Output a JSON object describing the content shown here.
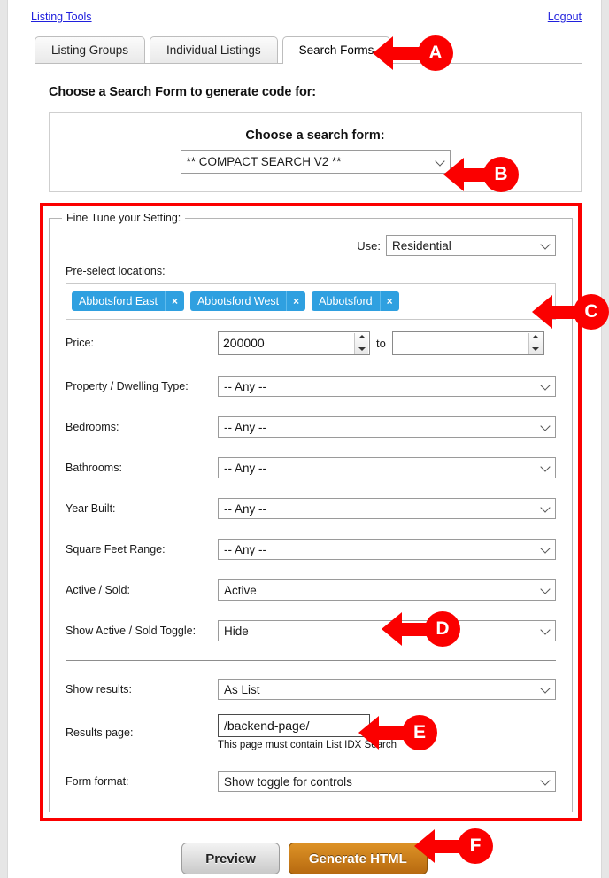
{
  "top": {
    "left_link": "Listing Tools",
    "right_link": "Logout"
  },
  "tabs": [
    {
      "label": "Listing Groups",
      "active": false
    },
    {
      "label": "Individual Listings",
      "active": false
    },
    {
      "label": "Search Forms",
      "active": true
    }
  ],
  "heading": "Choose a Search Form to generate code for:",
  "choose_panel": {
    "title": "Choose a search form:",
    "selected_form": "** COMPACT SEARCH V2 **"
  },
  "finetune": {
    "legend": "Fine Tune your Setting:",
    "use_label": "Use:",
    "use_value": "Residential",
    "preselect_label": "Pre-select locations:",
    "tags": [
      {
        "label": "Abbotsford East",
        "remove": "×"
      },
      {
        "label": "Abbotsford West",
        "remove": "×"
      },
      {
        "label": "Abbotsford",
        "remove": "×"
      }
    ],
    "price": {
      "label": "Price:",
      "min_value": "200000",
      "to_label": "to",
      "max_value": ""
    },
    "rows": [
      {
        "label": "Property / Dwelling Type:",
        "value": "-- Any --"
      },
      {
        "label": "Bedrooms:",
        "value": "-- Any --"
      },
      {
        "label": "Bathrooms:",
        "value": "-- Any --"
      },
      {
        "label": "Year Built:",
        "value": "-- Any --"
      },
      {
        "label": "Square Feet Range:",
        "value": "-- Any --"
      },
      {
        "label": "Active / Sold:",
        "value": "Active"
      },
      {
        "label": "Show Active / Sold Toggle:",
        "value": "Hide"
      }
    ],
    "show_results": {
      "label": "Show results:",
      "value": "As List"
    },
    "results_page": {
      "label": "Results page:",
      "value": "/backend-page/",
      "hint": "This page must contain List IDX Search"
    },
    "form_format": {
      "label": "Form format:",
      "value": "Show toggle for controls"
    }
  },
  "buttons": {
    "preview": "Preview",
    "generate": "Generate HTML"
  },
  "annotations": [
    {
      "letter": "A"
    },
    {
      "letter": "B"
    },
    {
      "letter": "C"
    },
    {
      "letter": "D"
    },
    {
      "letter": "E"
    },
    {
      "letter": "F"
    }
  ],
  "colors": {
    "annotation_red": "#fb0000",
    "tag_blue": "#2fa0e0",
    "link_blue": "#2020dd",
    "generate_orange": "#c87a16"
  }
}
